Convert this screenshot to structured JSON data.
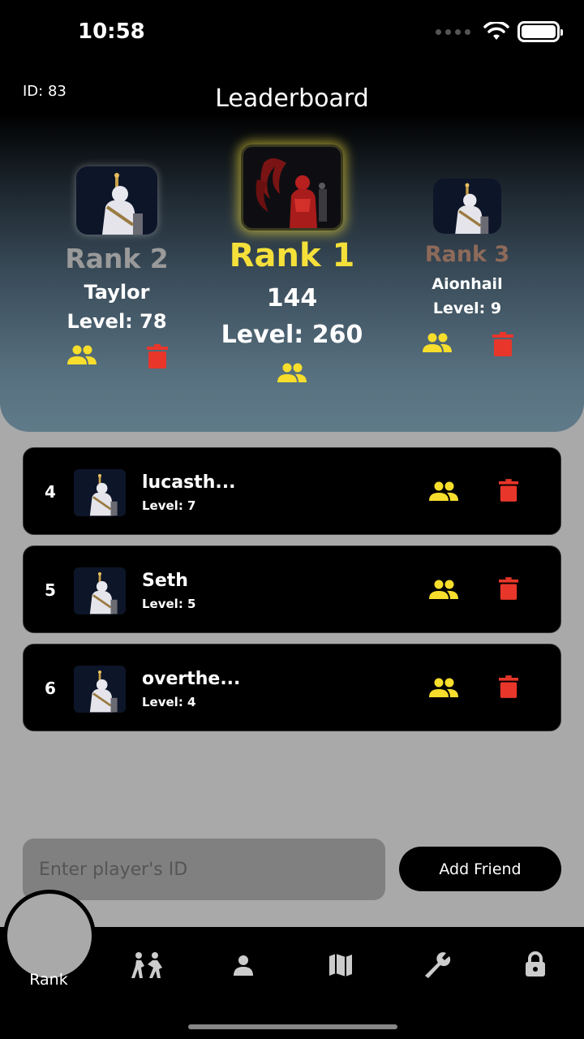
{
  "status": {
    "time": "10:58"
  },
  "header": {
    "user_id": "ID: 83",
    "title": "Leaderboard"
  },
  "podium": {
    "first": {
      "rank": "Rank 1",
      "score": "144",
      "level": "Level: 260"
    },
    "second": {
      "rank": "Rank 2",
      "name": "Taylor",
      "level": "Level: 78"
    },
    "third": {
      "rank": "Rank 3",
      "name": "Aionhail",
      "level": "Level: 9"
    }
  },
  "list": [
    {
      "rank": "4",
      "name": "lucasth...",
      "level": "Level: 7"
    },
    {
      "rank": "5",
      "name": "Seth",
      "level": "Level: 5"
    },
    {
      "rank": "6",
      "name": "overthe...",
      "level": "Level: 4"
    }
  ],
  "add_friend": {
    "placeholder": "Enter player's ID",
    "button": "Add Friend"
  },
  "tabs": {
    "rank_label": "Rank"
  },
  "colors": {
    "gold": "#f5e03a",
    "silver": "#9a9a9a",
    "bronze": "#8e6a5a",
    "friend": "#f7de2c",
    "delete": "#e8362a"
  }
}
